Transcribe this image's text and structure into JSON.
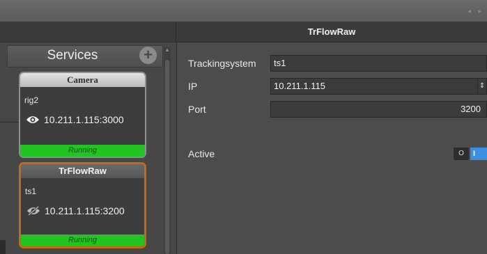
{
  "window": {
    "nav_arrows": "◂ ▸"
  },
  "panel": {
    "title": "TrFlowRaw"
  },
  "services": {
    "title": "Services",
    "add_icon": "plus-circle-icon",
    "add_label": "+",
    "cards": [
      {
        "title": "Camera",
        "subtitle": "rig2",
        "address": "10.211.1.115:3000",
        "icon": "eye-icon",
        "status": "Running",
        "selected": false
      },
      {
        "title": "TrFlowRaw",
        "subtitle": "ts1",
        "address": "10.211.1.115:3200",
        "icon": "eye-slash-icon",
        "status": "Running",
        "selected": true
      }
    ]
  },
  "form": {
    "trackingsystem": {
      "label": "Trackingsystem",
      "value": "ts1"
    },
    "ip": {
      "label": "IP",
      "value": "10.211.1.115",
      "spinner": "⇕"
    },
    "port": {
      "label": "Port",
      "value": "3200"
    },
    "active": {
      "label": "Active",
      "off_label": "O",
      "on_label": "I",
      "value": true
    }
  },
  "colors": {
    "accent_selected": "#c26a17",
    "status_running": "#21c421",
    "toggle_on": "#3a8fe0"
  }
}
